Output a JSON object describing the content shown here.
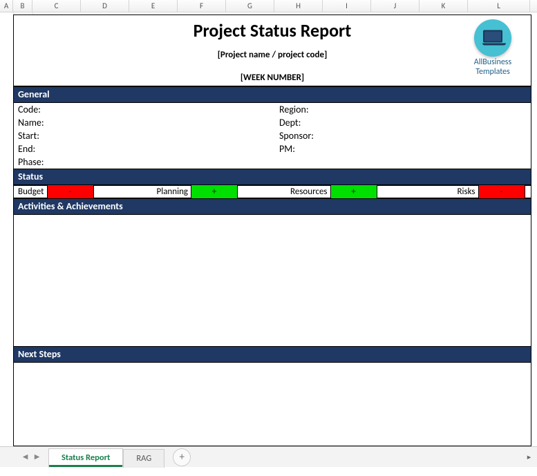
{
  "columns": [
    "A",
    "B",
    "C",
    "D",
    "E",
    "F",
    "G",
    "H",
    "I",
    "J",
    "K",
    "L"
  ],
  "logo": {
    "line1": "AllBusiness",
    "line2": "Templates"
  },
  "title": {
    "main": "Project Status Report",
    "sub": "[Project name / project code]",
    "week": "[WEEK NUMBER]"
  },
  "sections": {
    "general": "General",
    "status": "Status",
    "activities": "Activities & Achievements",
    "nextsteps": "Next Steps"
  },
  "general_fields": {
    "left": [
      "Code:",
      "Name:",
      "Start:",
      "End:",
      "Phase:"
    ],
    "right": [
      "Region:",
      "Dept:",
      "Sponsor:",
      "PM:"
    ]
  },
  "status_items": [
    {
      "label": "Budget",
      "symbol": "-",
      "color": "red"
    },
    {
      "label": "Planning",
      "symbol": "+",
      "color": "green"
    },
    {
      "label": "Resources",
      "symbol": "+",
      "color": "green"
    },
    {
      "label": "Risks",
      "symbol": "-",
      "color": "red"
    }
  ],
  "tabs": {
    "active": "Status Report",
    "other": "RAG",
    "add": "+"
  },
  "colors": {
    "section_header_bg": "#1f3864",
    "status_red": "#ff0000",
    "status_green": "#00e000",
    "logo_circle": "#46c0d3",
    "tab_active_accent": "#1a7f4b"
  }
}
